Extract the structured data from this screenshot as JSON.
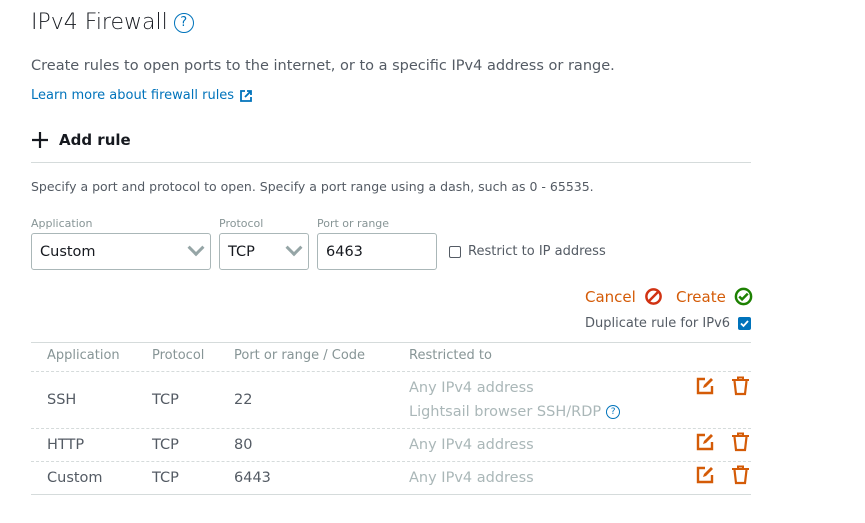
{
  "header": {
    "title": "IPv4 Firewall",
    "help_icon": "question-circle-icon"
  },
  "description": "Create rules to open ports to the internet, or to a specific IPv4 address or range.",
  "learn_more": "Learn more about firewall rules",
  "add_rule": "Add rule",
  "hint": "Specify a port and protocol to open. Specify a port range using a dash, such as 0 - 65535.",
  "form": {
    "application_label": "Application",
    "application_value": "Custom",
    "protocol_label": "Protocol",
    "protocol_value": "TCP",
    "port_label": "Port or range",
    "port_value": "6463",
    "restrict_label": "Restrict to IP address",
    "restrict_checked": false,
    "cancel": "Cancel",
    "create": "Create",
    "duplicate_label": "Duplicate rule for IPv6",
    "duplicate_checked": true
  },
  "colors": {
    "accent": "#d45b07",
    "link": "#0073bb",
    "cancel_icon": "#d13212",
    "create_icon": "#1d8102"
  },
  "table": {
    "headers": [
      "Application",
      "Protocol",
      "Port or range / Code",
      "Restricted to"
    ],
    "rows": [
      {
        "application": "SSH",
        "protocol": "TCP",
        "port": "22",
        "restricted": "Any IPv4 address",
        "extra": "Lightsail browser SSH/RDP"
      },
      {
        "application": "HTTP",
        "protocol": "TCP",
        "port": "80",
        "restricted": "Any IPv4 address"
      },
      {
        "application": "Custom",
        "protocol": "TCP",
        "port": "6443",
        "restricted": "Any IPv4 address"
      }
    ]
  }
}
